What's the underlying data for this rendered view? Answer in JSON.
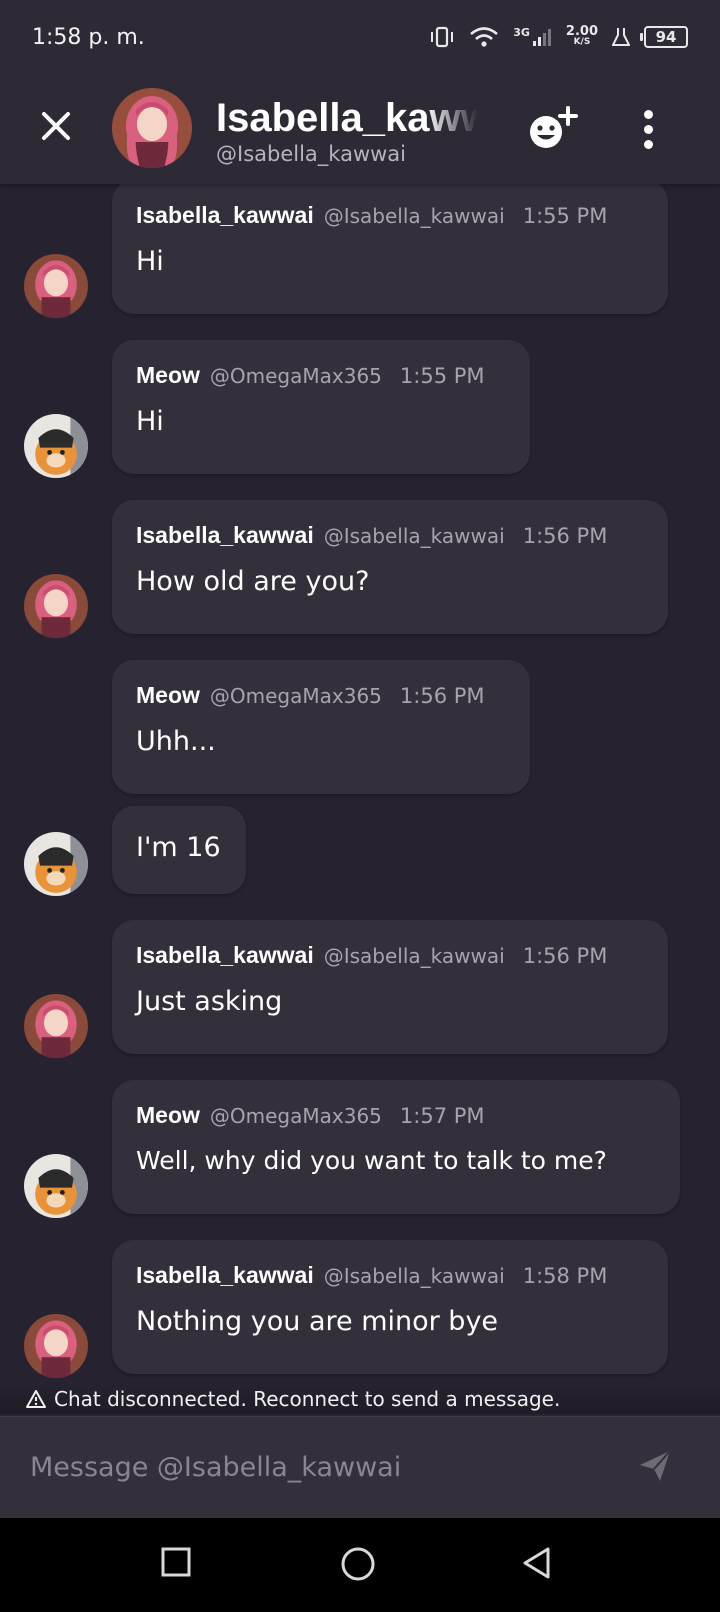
{
  "status_bar": {
    "time": "1:58 p. m.",
    "network_type": "3G",
    "speed_value": "2.00",
    "speed_unit": "K/S",
    "battery": "94"
  },
  "header": {
    "title": "Isabella_kawwai",
    "handle": "@Isabella_kawwai"
  },
  "messages": [
    {
      "author": "Isabella_kawwai",
      "handle": "@Isabella_kawwai",
      "time": "1:55 PM",
      "text": "Hi",
      "avatar": "girl"
    },
    {
      "author": "Meow",
      "handle": "@OmegaMax365",
      "time": "1:55 PM",
      "text": "Hi",
      "avatar": "cat"
    },
    {
      "author": "Isabella_kawwai",
      "handle": "@Isabella_kawwai",
      "time": "1:56 PM",
      "text": "How old are you?",
      "avatar": "girl"
    },
    {
      "author": "Meow",
      "handle": "@OmegaMax365",
      "time": "1:56 PM",
      "text": "Uhh...",
      "avatar": "cat",
      "continuation": "I'm 16"
    },
    {
      "author": "Isabella_kawwai",
      "handle": "@Isabella_kawwai",
      "time": "1:56 PM",
      "text": "Just asking",
      "avatar": "girl"
    },
    {
      "author": "Meow",
      "handle": "@OmegaMax365",
      "time": "1:57 PM",
      "text": "Well, why did you want to talk to me?",
      "avatar": "cat"
    },
    {
      "author": "Isabella_kawwai",
      "handle": "@Isabella_kawwai",
      "time": "1:58 PM",
      "text": "Nothing you are minor bye",
      "avatar": "girl"
    }
  ],
  "warning": {
    "icon": "warning-triangle-icon",
    "text": "Chat disconnected. Reconnect to send a message."
  },
  "composer": {
    "placeholder": "Message @Isabella_kawwai"
  },
  "colors": {
    "background": "#262230",
    "bubble": "#332f3b",
    "header": "#2e2a35",
    "muted_text": "#a8a4ae"
  }
}
